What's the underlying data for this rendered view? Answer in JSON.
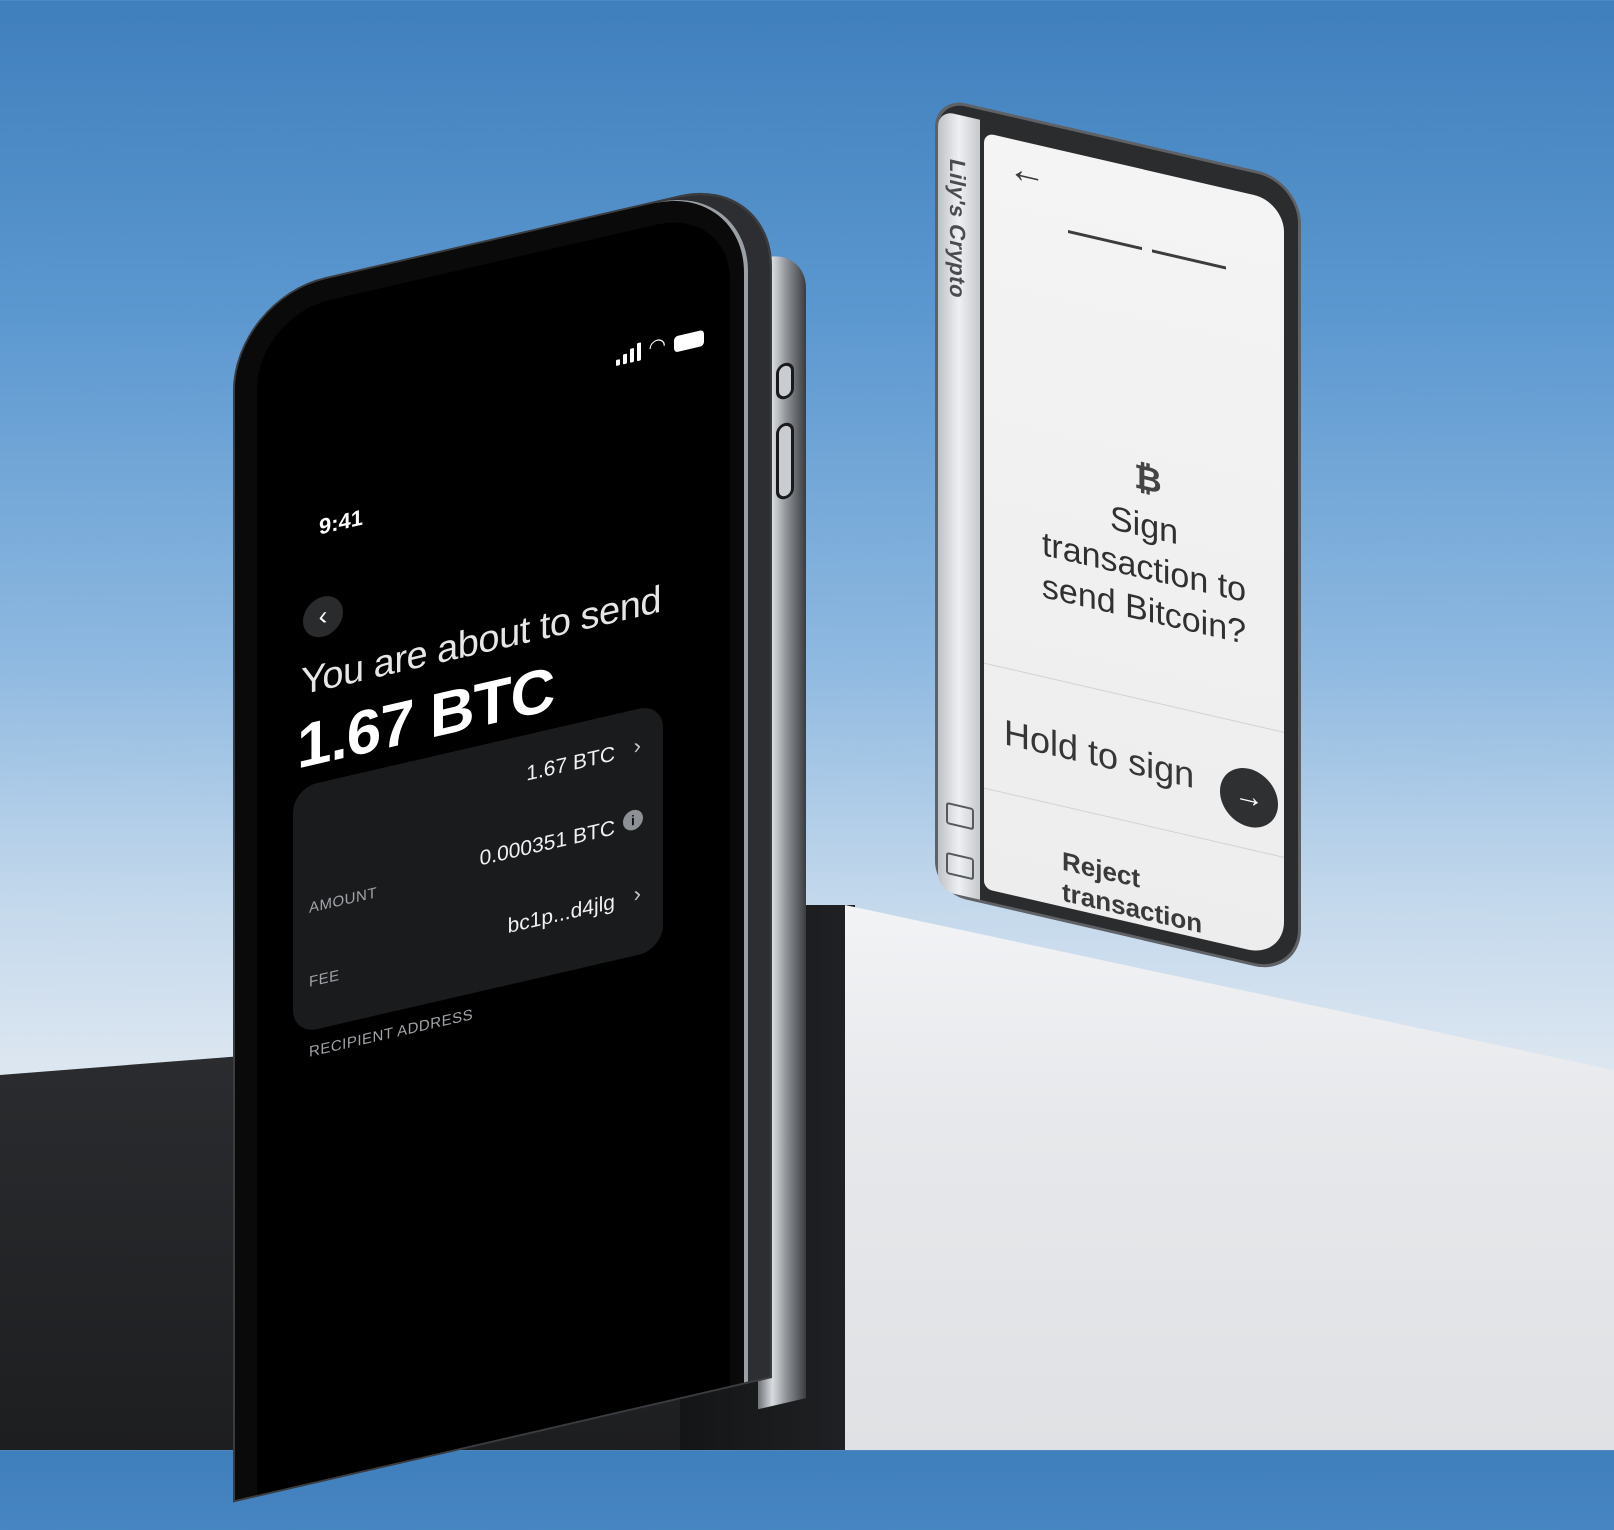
{
  "phone": {
    "status_time": "9:41",
    "status_icons": [
      "signal-icon",
      "wifi-icon",
      "battery-icon"
    ],
    "title": "You are about to send",
    "amount": "1.67 BTC",
    "details": [
      {
        "label": "AMOUNT",
        "value": "1.67 BTC",
        "action": "chevron-right-icon"
      },
      {
        "label": "FEE",
        "value": "0.000351 BTC",
        "action": "info-icon"
      },
      {
        "label": "RECIPIENT ADDRESS",
        "value": "bc1p...d4jlg",
        "action": "chevron-right-icon"
      }
    ],
    "info_glyph": "i",
    "chevron_glyph": "›",
    "back_glyph": "‹"
  },
  "wallet": {
    "device_name": "Lily's Crypto",
    "back_glyph": "←",
    "coin_glyph": "₿",
    "question": "Sign transaction to send Bitcoin?",
    "hold_label": "Hold to sign",
    "go_glyph": "→",
    "reject_label": "Reject transaction",
    "progress_steps": 2
  },
  "colors": {
    "sky_top": "#3f7fbc",
    "phone_screen": "#000000",
    "card_bg": "#1a1b1d",
    "wallet_screen": "#f4f4f4",
    "wallet_button": "#2f3032"
  }
}
